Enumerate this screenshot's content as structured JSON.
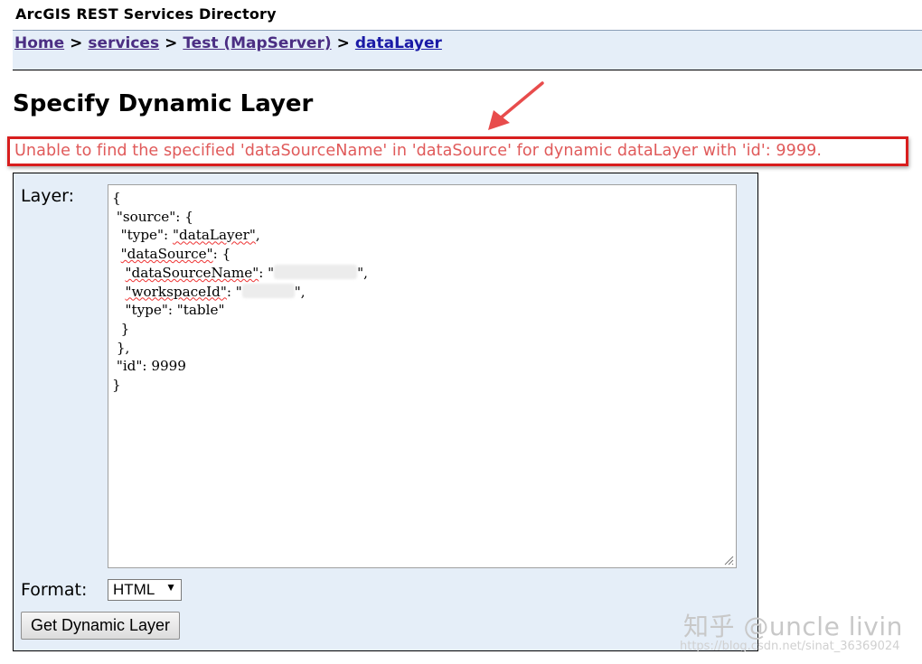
{
  "header": {
    "title": "ArcGIS REST Services Directory"
  },
  "breadcrumb": {
    "items": [
      "Home",
      "services",
      "Test (MapServer)",
      "dataLayer"
    ],
    "separator": ">"
  },
  "page": {
    "title": "Specify Dynamic Layer"
  },
  "error": {
    "message": "Unable to find the specified 'dataSourceName' in 'dataSource' for dynamic dataLayer with 'id': 9999."
  },
  "form": {
    "layer_label": "Layer:",
    "layer_code": {
      "open_brace": "{",
      "source_key": "\"source\": {",
      "type_key": "\"type\"",
      "type_value": "\"dataLayer\"",
      "datasource_key": "\"dataSource\"",
      "datasourcename_key": "\"dataSourceName\"",
      "workspaceid_key": "\"workspaceId\"",
      "inner_type": "\"type\": \"table\"",
      "id_line": "\"id\": 9999"
    },
    "format_label": "Format:",
    "format_value": "HTML",
    "submit_label": "Get Dynamic Layer"
  },
  "watermark": {
    "text": "知乎 @uncle livin",
    "url": "https://blog.csdn.net/sinat_36369024"
  },
  "colors": {
    "error_border": "#d81e1e",
    "error_text": "#e05a5a",
    "panel_bg": "#e5eef8"
  }
}
